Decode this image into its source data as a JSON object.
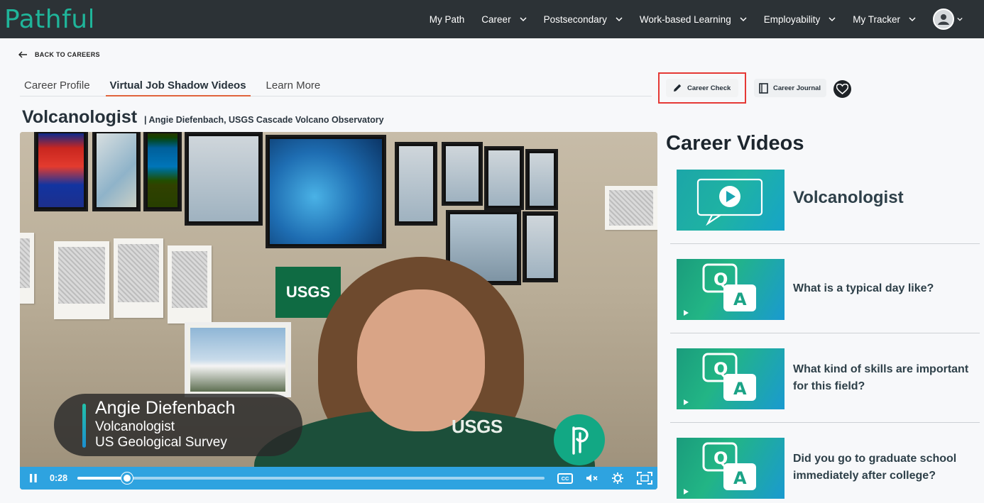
{
  "brand": {
    "logo_text": "Pathful"
  },
  "nav": {
    "items": [
      {
        "label": "My Path"
      },
      {
        "label": "Career"
      },
      {
        "label": "Postsecondary"
      },
      {
        "label": "Work-based Learning"
      },
      {
        "label": "Employability"
      },
      {
        "label": "My Tracker"
      }
    ]
  },
  "back": {
    "label": "BACK TO CAREERS"
  },
  "tabs": [
    {
      "label": "Career Profile"
    },
    {
      "label": "Virtual Job Shadow Videos"
    },
    {
      "label": "Learn More"
    }
  ],
  "actions": {
    "career_check": "Career Check",
    "career_journal": "Career Journal"
  },
  "header": {
    "title": "Volcanologist",
    "subtitle": "| Angie Diefenbach, USGS Cascade Volcano Observatory"
  },
  "video": {
    "lower_third": {
      "name": "Angie Diefenbach",
      "role": "Volcanologist",
      "org": "US Geological Survey"
    },
    "sign_text": "USGS",
    "shirt_text": "USGS",
    "time": "0:28",
    "progress_fraction": 0.107,
    "cc_label": "CC"
  },
  "sidebar": {
    "heading": "Career Videos",
    "items": [
      {
        "label": "Volcanologist",
        "thumb": "play-icon"
      },
      {
        "label": "What is a typical day like?",
        "thumb": "qa-icon"
      },
      {
        "label": "What kind of skills are important for this field?",
        "thumb": "qa-icon"
      },
      {
        "label": "Did you go to graduate school immediately after college?",
        "thumb": "qa-icon"
      }
    ]
  },
  "colors": {
    "accent_tab": "#e0643c",
    "topbar": "#2c3236",
    "highlight_frame": "#e53935",
    "controls": "#2ea3e0",
    "brand": "#1fb59a"
  }
}
